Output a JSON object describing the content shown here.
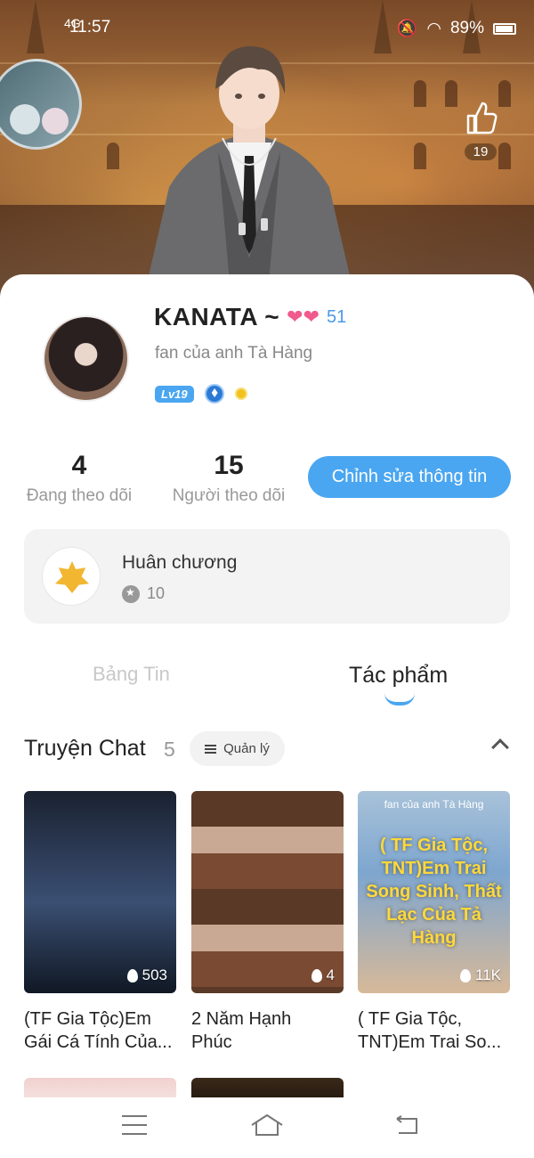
{
  "status_bar": {
    "signal_label": "4G",
    "time": "11:57",
    "battery": "89%"
  },
  "header": {
    "like_count": "19"
  },
  "profile": {
    "username": "KANATA ~",
    "heart_count": "51",
    "bio": "fan của anh Tà Hàng",
    "level": "Lv19"
  },
  "stats": {
    "following_count": "4",
    "following_label": "Đang theo dõi",
    "followers_count": "15",
    "followers_label": "Người theo dõi"
  },
  "edit_button_label": "Chỉnh sửa thông tin",
  "medal": {
    "title": "Huân chương",
    "count": "10"
  },
  "tabs": [
    {
      "label": "Bảng Tin",
      "active": false
    },
    {
      "label": "Tác phẩm",
      "active": true
    }
  ],
  "section": {
    "title": "Truyện Chat",
    "count": "5",
    "manage_label": "Quản lý"
  },
  "stories": [
    {
      "title_line1": "(TF Gia Tộc)Em",
      "title_line2": "Gái Cá Tính Của...",
      "count": "503"
    },
    {
      "title_line1": "2 Năm Hạnh",
      "title_line2": "Phúc",
      "count": "4"
    },
    {
      "title_line1": "( TF Gia Tộc,",
      "title_line2": "TNT)Em Trai So...",
      "count": "11K",
      "cover_top_text": "fan của anh Tà Hàng",
      "cover_text": "( TF Gia Tộc, TNT)Em Trai Song Sinh, Thất Lạc Của Tả Hàng"
    }
  ],
  "icons": {
    "like": "thumbs-up-icon",
    "manage": "list-settings-icon",
    "collapse": "chevron-up-icon",
    "nav_menu": "menu-icon",
    "nav_home": "home-icon",
    "nav_back": "back-icon"
  },
  "colors": {
    "accent": "#4aa6f0",
    "heart": "#f05a8c",
    "coin": "#f3c11c"
  }
}
